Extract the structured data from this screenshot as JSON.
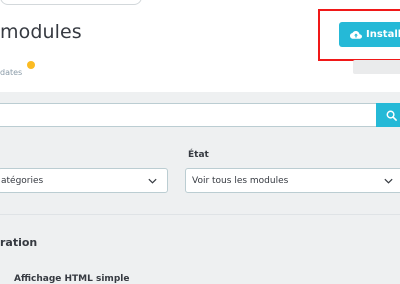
{
  "header": {
    "title": "modules",
    "install_button_label": "Installer",
    "tab_updates_label": "dates",
    "updates_badge": ""
  },
  "search": {
    "value": "",
    "placeholder": ""
  },
  "filters": {
    "category": {
      "label": "",
      "selected": "atégories"
    },
    "state": {
      "label": "État",
      "selected": "Voir tous les modules"
    }
  },
  "section": {
    "title": "ration"
  },
  "modules": [
    {
      "name": "Affichage HTML simple"
    }
  ],
  "colors": {
    "accent": "#25b9d7",
    "highlight": "#f01818",
    "badge": "#fbbb22"
  },
  "icons": {
    "install": "cloud-upload-icon",
    "search": "search-icon",
    "select": "chevron-down-icon"
  }
}
